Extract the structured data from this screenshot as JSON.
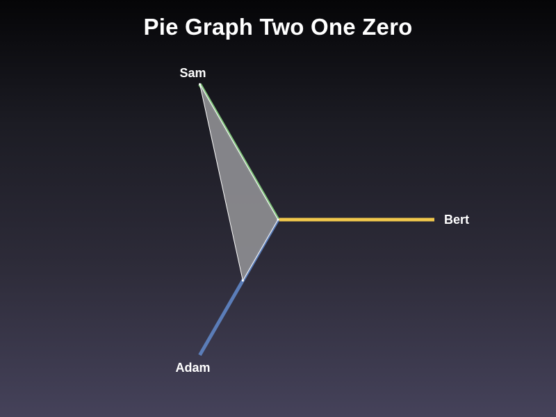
{
  "chart_data": {
    "type": "radar",
    "title": "Pie Graph Two One Zero",
    "axes": [
      {
        "name": "Bert",
        "color": "#f2c94c"
      },
      {
        "name": "Adam",
        "color": "#5b7db8"
      },
      {
        "name": "Sam",
        "color": "#7fc27a"
      }
    ],
    "series": [
      {
        "values": [
          0.0,
          0.45,
          1.0
        ],
        "fill": "#8a8a8e",
        "stroke": "#ffffff"
      }
    ],
    "max": 1.0,
    "grid": false,
    "legend": "none"
  }
}
